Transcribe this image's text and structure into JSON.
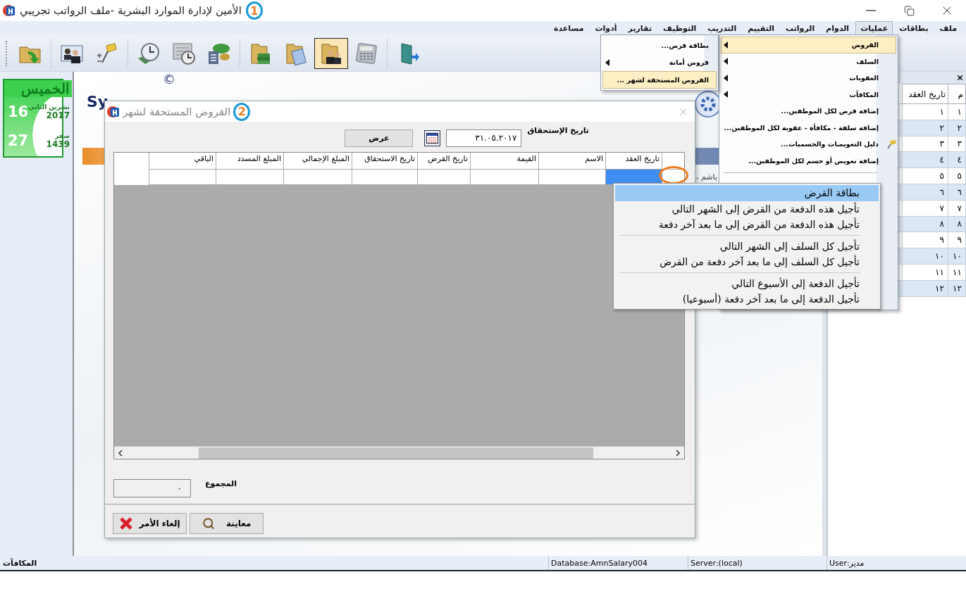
{
  "window": {
    "title": "الأمين لإدارة الموارد البشرية -ملف الرواتب تجريبي",
    "annotation": "1"
  },
  "menu_bar": [
    {
      "label": "ملف",
      "selected": false
    },
    {
      "label": "بطاقات",
      "selected": false
    },
    {
      "label": "عمليات",
      "selected": true
    },
    {
      "label": "الدوام",
      "selected": false
    },
    {
      "label": "الرواتب",
      "selected": false
    },
    {
      "label": "التقييم",
      "selected": false
    },
    {
      "label": "التدريب",
      "selected": false
    },
    {
      "label": "التوظيف",
      "selected": false
    },
    {
      "label": "تقارير",
      "selected": false
    },
    {
      "label": "أدوات",
      "selected": false
    },
    {
      "label": "مساعدة",
      "selected": false
    }
  ],
  "toolbar": [
    {
      "kind": "folder-arrow",
      "selected": false
    },
    {
      "kind": "separator"
    },
    {
      "kind": "id-card",
      "selected": false
    },
    {
      "kind": "pin",
      "selected": false
    },
    {
      "kind": "separator"
    },
    {
      "kind": "clock",
      "selected": false
    },
    {
      "kind": "calendar-clock",
      "selected": false
    },
    {
      "kind": "money",
      "selected": false
    },
    {
      "kind": "separator"
    },
    {
      "kind": "folder-books",
      "selected": false
    },
    {
      "kind": "folder-document",
      "selected": false
    },
    {
      "kind": "folder-people",
      "selected": true
    },
    {
      "kind": "calculator",
      "selected": false
    },
    {
      "kind": "separator"
    },
    {
      "kind": "exit",
      "selected": false
    }
  ],
  "calendar": {
    "weekday": "الخميس",
    "month": "تشرين الثاني",
    "day": "16",
    "year": "2017",
    "hijri_month": "صفر",
    "hijri_day": "27",
    "hijri_year": "1439"
  },
  "splash": {
    "logo": "Sy",
    "copyright": "©",
    "peek_text": "، باشم"
  },
  "operations_menu": [
    {
      "kind": "submenu",
      "label": "القروض",
      "selected": true
    },
    {
      "kind": "submenu",
      "label": "السلف",
      "selected": false
    },
    {
      "kind": "submenu",
      "label": "العقوبات",
      "selected": false
    },
    {
      "kind": "submenu",
      "label": "المكافآت",
      "selected": false
    },
    {
      "kind": "command",
      "label": "إضافة قرض لكل الموظفين...",
      "selected": false
    },
    {
      "kind": "command",
      "label": "إضافة سلفة - مكافأة - عقوبة لكل الموظفين...",
      "selected": false
    },
    {
      "kind": "command-icon",
      "label": "دليل التعويضات والحسميات...",
      "selected": false
    },
    {
      "kind": "command",
      "label": "إضافة تعويض أو حسم لكل الموظفين...",
      "selected": false
    },
    {
      "kind": "separator"
    }
  ],
  "loans_submenu": [
    {
      "kind": "command",
      "label": "بطاقة قرض...",
      "selected": false
    },
    {
      "kind": "submenu",
      "label": "قروض أمانة",
      "selected": false
    },
    {
      "kind": "command",
      "label": "القروض المستحقة لشهر ...",
      "selected": true
    }
  ],
  "side_panel": {
    "columns": [
      "م",
      "تاريخ العقد"
    ],
    "rows": [
      [
        "١",
        "١"
      ],
      [
        "٢",
        "٢"
      ],
      [
        "٣",
        "٣"
      ],
      [
        "٤",
        "٤"
      ],
      [
        "٥",
        "٥"
      ],
      [
        "٦",
        "٦"
      ],
      [
        "٧",
        "٧"
      ],
      [
        "٨",
        "٨"
      ],
      [
        "٩",
        "٩"
      ],
      [
        "١٠",
        "١٠"
      ],
      [
        "١١",
        "١١"
      ],
      [
        "١٢",
        "١٢"
      ]
    ]
  },
  "dialog": {
    "title": "القروض المستحقة لشهر",
    "annotation": "2",
    "date_label": "تاريخ الإستحقاق",
    "date_value": "٣١.٠٥.٢٠١٧",
    "show_button": "عرض",
    "columns": [
      "تاريخ العقد",
      "الاسم",
      "القيمة",
      "تاريخ القرض",
      "تاريخ الاستحقاق",
      "المبلغ الإجمالي",
      "المبلغ المسدد",
      "الباقي"
    ],
    "row": [
      {
        "selected": true
      },
      {
        "selected": false
      },
      {
        "selected": false
      },
      {
        "selected": false
      },
      {
        "selected": false
      },
      {
        "selected": false
      },
      {
        "selected": false
      },
      {
        "selected": false
      }
    ],
    "total_label": "المجموع",
    "total_value": "٠",
    "buttons": [
      {
        "kind": "preview",
        "label": "معاينة"
      },
      {
        "kind": "cancel",
        "label": "إلغاء الأمر"
      }
    ]
  },
  "context_menu": [
    {
      "kind": "item",
      "label": "بطاقة القرض",
      "selected": true
    },
    {
      "kind": "item",
      "label": "تأجيل هذه الدفعة من القرض إلى الشهر التالي",
      "selected": false
    },
    {
      "kind": "item",
      "label": "تأجيل هذه الدفعة من القرض إلى ما بعد آخر دفعة",
      "selected": false
    },
    {
      "kind": "separator"
    },
    {
      "kind": "item",
      "label": "تأجيل كل السلف إلى الشهر التالي",
      "selected": false
    },
    {
      "kind": "item",
      "label": "تأجيل كل السلف إلى ما بعد آخر دفعة من القرض",
      "selected": false
    },
    {
      "kind": "separator"
    },
    {
      "kind": "item",
      "label": "تأجيل الدفعة إلى الأسبوع التالي",
      "selected": false
    },
    {
      "kind": "item",
      "label": "تأجيل الدفعة إلى ما بعد آخر دفعة (أسبوعيا)",
      "selected": false
    }
  ],
  "status_bar": {
    "section": "المكافآت",
    "database": "Database:AmnSalary004",
    "server": "Server:(local)",
    "user": "User:مدير"
  }
}
